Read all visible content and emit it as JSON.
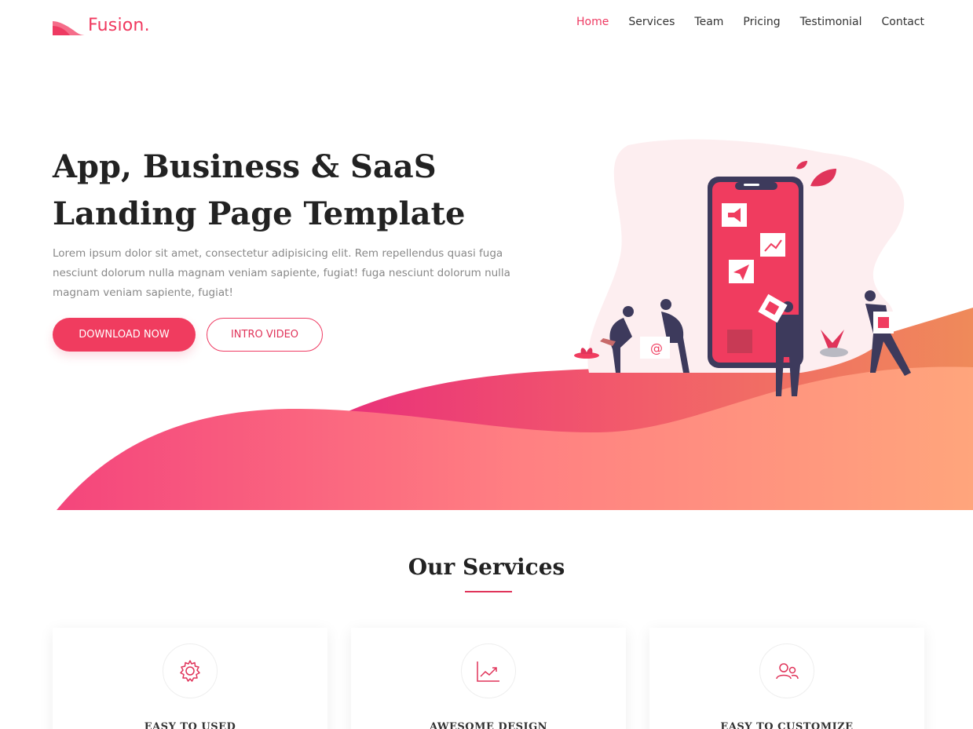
{
  "header": {
    "logo_text": "Fusion.",
    "nav": [
      {
        "label": "Home",
        "active": true
      },
      {
        "label": "Services"
      },
      {
        "label": "Team"
      },
      {
        "label": "Pricing"
      },
      {
        "label": "Testimonial"
      },
      {
        "label": "Contact"
      }
    ]
  },
  "hero": {
    "title_line1": "App, Business & SaaS",
    "title_line2": "Landing Page Template",
    "text": "Lorem ipsum dolor sit amet, consectetur adipisicing elit. Rem repellendus quasi fuga nesciunt dolorum nulla magnam veniam sapiente, fugiat! fuga nesciunt dolorum nulla magnam veniam sapiente, fugiat!",
    "primary_button": "DOWNLOAD NOW",
    "secondary_button": "INTRO VIDEO",
    "illustration_glyphs": {
      "email": "@"
    }
  },
  "services": {
    "title": "Our Services",
    "cards": [
      {
        "title": "EASY TO USED",
        "icon": "gear-icon"
      },
      {
        "title": "AWESOME DESIGN",
        "icon": "chart-icon"
      },
      {
        "title": "EASY TO CUSTOMIZE",
        "icon": "users-icon"
      }
    ]
  },
  "colors": {
    "accent": "#f03c5f",
    "gradient_start": "#f4457c",
    "gradient_end": "#ffa57c",
    "blob": "#fdeef0",
    "text_dark": "#222222",
    "text_muted": "#888888"
  }
}
